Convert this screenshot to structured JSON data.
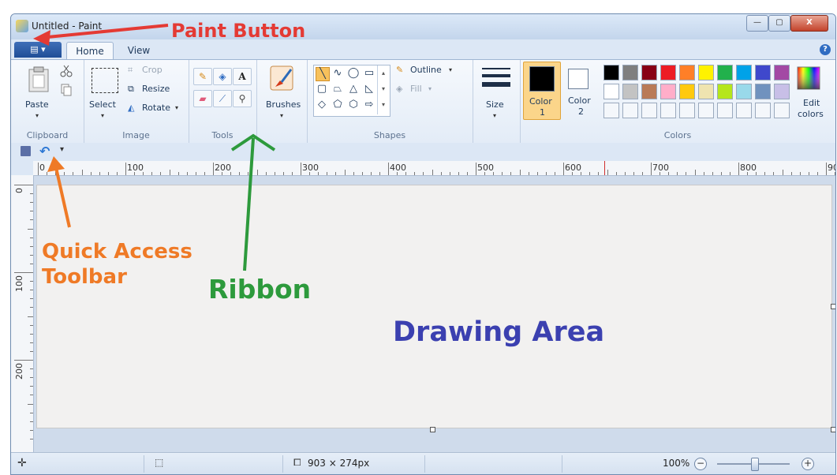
{
  "window": {
    "title": "Untitled - Paint",
    "controls": {
      "minimize": "—",
      "maximize": "▢",
      "close": "X"
    }
  },
  "tabs": {
    "paint_button": "▤ ▾",
    "home": "Home",
    "view": "View",
    "help": "?"
  },
  "ribbon": {
    "clipboard": {
      "paste": "Paste",
      "label": "Clipboard"
    },
    "image": {
      "select": "Select",
      "crop": "Crop",
      "resize": "Resize",
      "rotate": "Rotate",
      "label": "Image"
    },
    "tools": {
      "label": "Tools",
      "text_tool": "A"
    },
    "brushes": {
      "label": "Brushes"
    },
    "shapes": {
      "outline": "Outline",
      "fill": "Fill",
      "label": "Shapes"
    },
    "size": {
      "label": "Size"
    },
    "colors": {
      "color1": "Color",
      "color1_num": "1",
      "color2": "Color",
      "color2_num": "2",
      "edit_line1": "Edit",
      "edit_line2": "colors",
      "label": "Colors",
      "color1_value": "#000000",
      "color2_value": "#ffffff",
      "palette_row1": [
        "#000000",
        "#7f7f7f",
        "#880015",
        "#ed1c24",
        "#ff7f27",
        "#fff200",
        "#22b14c",
        "#00a2e8",
        "#3f48cc",
        "#a349a4"
      ],
      "palette_row2": [
        "#ffffff",
        "#c3c3c3",
        "#b97a57",
        "#ffaec9",
        "#ffc90e",
        "#efe4b0",
        "#b5e61d",
        "#99d9ea",
        "#7092be",
        "#c8bfe7"
      ]
    }
  },
  "ruler": {
    "horizontal": [
      "0",
      "100",
      "200",
      "300",
      "400",
      "500",
      "600",
      "700",
      "800",
      "90"
    ],
    "vertical": [
      "0",
      "100",
      "200"
    ]
  },
  "status": {
    "dimensions": "903 × 274px",
    "zoom": "100%"
  },
  "annotations": {
    "paint_button": "Paint Button",
    "quick_access_line1": "Quick Access",
    "quick_access_line2": "Toolbar",
    "ribbon": "Ribbon",
    "drawing_area": "Drawing Area"
  }
}
